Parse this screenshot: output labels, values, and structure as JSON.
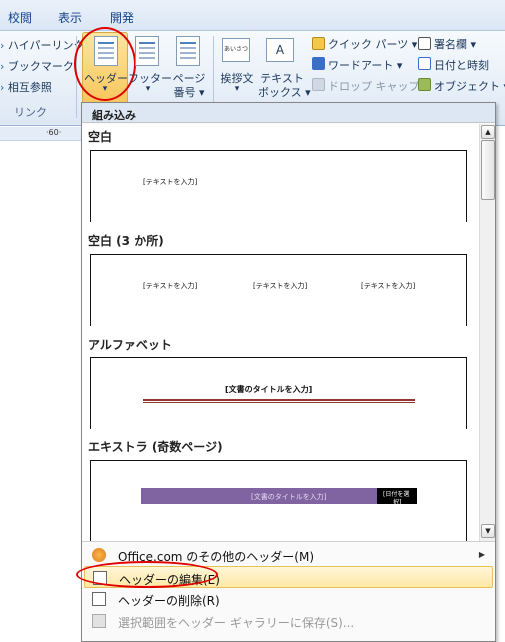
{
  "tabs": [
    "校閲",
    "表示",
    "開発"
  ],
  "ribbon": {
    "links": [
      "ハイパーリンク",
      "ブックマーク",
      "相互参照"
    ],
    "links_group": "リンク",
    "header": [
      "ヘッダー",
      "▾"
    ],
    "footer": [
      "フッター",
      "▾"
    ],
    "page_number": [
      "ページ",
      "番号 ▾"
    ],
    "greeting": [
      "挨拶文",
      "▾"
    ],
    "greeting_icon_text": "あいさつ",
    "textbox": [
      "テキスト",
      "ボックス ▾"
    ],
    "textbox_icon_text": "A",
    "quick_parts": "クイック パーツ ▾",
    "wordart": "ワードアート ▾",
    "dropcap": "ドロップ キャップ ▾",
    "signature": "署名欄 ▾",
    "datetime": "日付と時刻",
    "object": "オブジェクト ▾"
  },
  "ruler_text": "·60·",
  "dropdown": {
    "header": "組み込み",
    "sections": [
      {
        "title": "空白",
        "placeholders": [
          "[テキストを入力]"
        ]
      },
      {
        "title": "空白 (3 か所)",
        "placeholders": [
          "[テキストを入力]",
          "[テキストを入力]",
          "[テキストを入力]"
        ]
      },
      {
        "title": "アルファベット",
        "placeholders": [
          "[文書のタイトルを入力]"
        ]
      },
      {
        "title": "エキストラ (奇数ページ)",
        "placeholders": [
          "[文書のタイトルを入力]",
          "[日付を選",
          "択]"
        ]
      }
    ],
    "menu": [
      {
        "label": "Office.com のその他のヘッダー(M)",
        "arrow": "▶"
      },
      {
        "label": "ヘッダーの編集(E)"
      },
      {
        "label": "ヘッダーの削除(R)"
      },
      {
        "label": "選択範囲をヘッダー ギャラリーに保存(S)..."
      }
    ]
  },
  "colors": {
    "accent_purple": "#8064a2",
    "highlight_oval": "#e00000",
    "title_rule": "#943634"
  }
}
